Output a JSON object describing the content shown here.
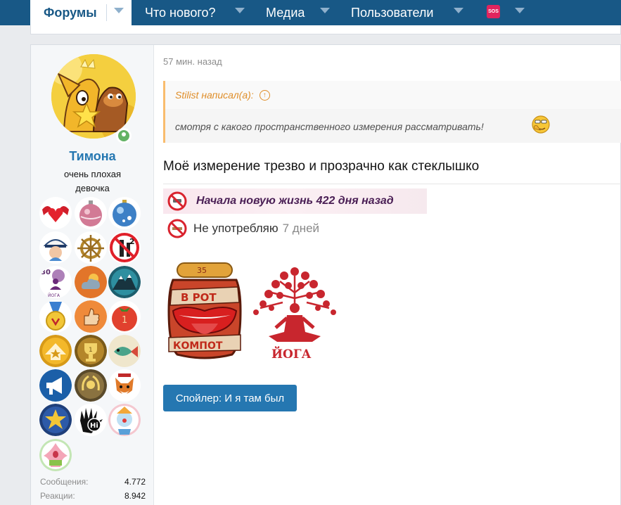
{
  "nav": {
    "tabs": [
      {
        "label": "Форумы",
        "active": true
      },
      {
        "label": "Что нового?"
      },
      {
        "label": "Медиа"
      },
      {
        "label": "Пользователи"
      }
    ],
    "sos_badge": "SOS",
    "colors": {
      "bar": "#185886",
      "active_text": "#185886"
    }
  },
  "user": {
    "name": "Тимона",
    "title": "очень плохая девочка",
    "online": true,
    "trophies": [
      "winged-heart-trophy-icon",
      "pink-ornament-trophy-icon",
      "blue-ornament-trophy-icon",
      "captain-trophy-icon",
      "ship-wheel-trophy-icon",
      "no-alcohol-trophy-icon",
      "yoga-30-trophy-icon",
      "weather-trophy-icon",
      "mountain-trophy-icon",
      "medal-trophy-icon",
      "thumbs-up-trophy-icon",
      "tomato-trophy-icon",
      "star-up-trophy-icon",
      "gold-cup-trophy-icon",
      "fish-trophy-icon",
      "megaphone-trophy-icon",
      "laurel-trophy-icon",
      "fox-trophy-icon",
      "star-badge-trophy-icon",
      "hi-hand-trophy-icon",
      "clown-trophy-icon",
      "patrick-trophy-icon"
    ],
    "stats": [
      {
        "label": "Сообщения:",
        "value": "4.772"
      },
      {
        "label": "Реакции:",
        "value": "8.942"
      }
    ]
  },
  "post": {
    "time": "57 мин. назад",
    "quote": {
      "author_line": "Stilist написал(а):",
      "text": "смотря с какого пространственного измерения рассматривать!"
    },
    "message": "Моё измерение трезво и прозрачно как стеклышко",
    "signature": {
      "line1": "Начала новую жизнь 422 дня назад",
      "line2_prefix": "Не употребляю",
      "line2_suffix": "7 дней",
      "compot_top": "35",
      "compot_line1": "В РОТ",
      "compot_line2": "КОМПОТ",
      "yoga_label": "ЙОГА"
    },
    "spoiler_button": "Спойлер: И я там был"
  },
  "colors": {
    "link_blue": "#2577b1",
    "quote_orange": "#df8d28",
    "quote_border": "#f9bc6d",
    "online_green": "#63b265"
  }
}
